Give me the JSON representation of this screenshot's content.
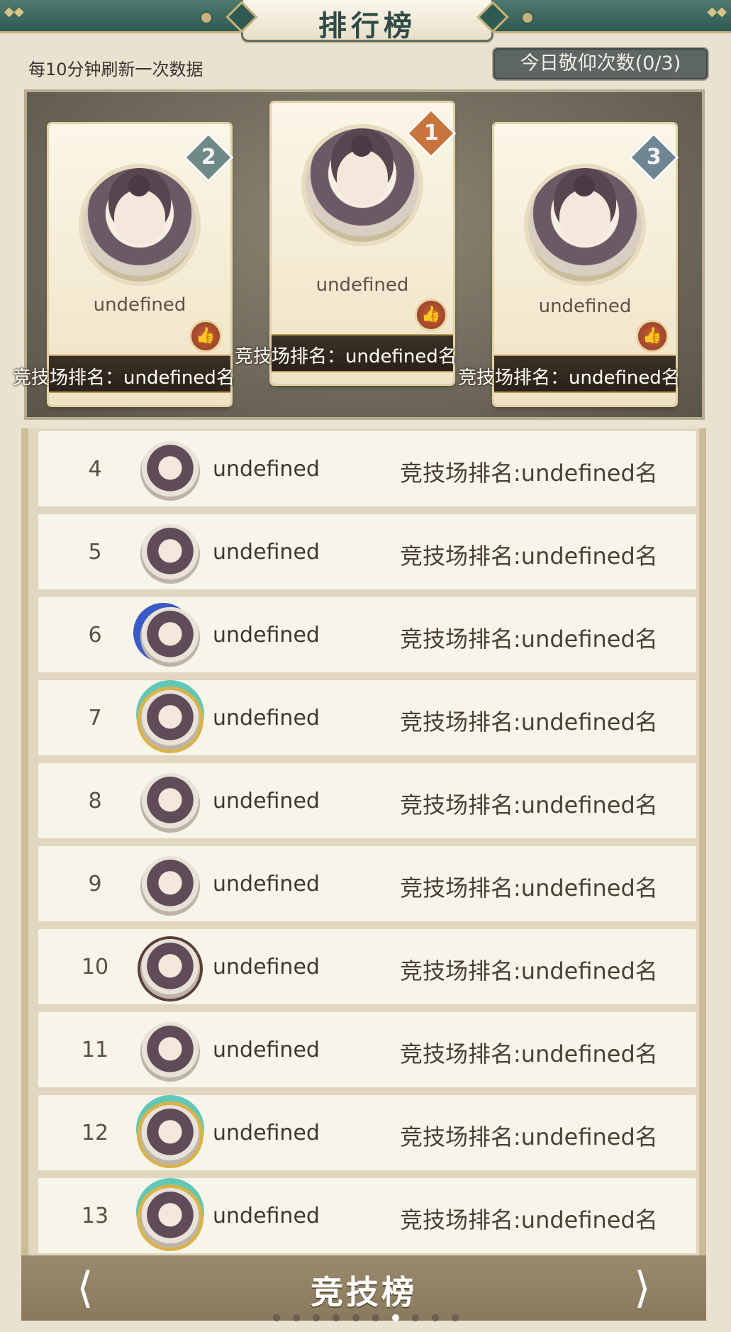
{
  "header": {
    "title": "排行榜"
  },
  "refresh_text": "每10分钟刷新一次数据",
  "worship_button": "今日敬仰次数(0/3)",
  "podium": [
    {
      "rank": "2",
      "name": "undefined",
      "arena": "竞技场排名：undefined名"
    },
    {
      "rank": "1",
      "name": "undefined",
      "arena": "竞技场排名：undefined名"
    },
    {
      "rank": "3",
      "name": "undefined",
      "arena": "竞技场排名：undefined名"
    }
  ],
  "list": [
    {
      "rank": "4",
      "name": "undefined",
      "arena": "竞技场排名:undefined名"
    },
    {
      "rank": "5",
      "name": "undefined",
      "arena": "竞技场排名:undefined名"
    },
    {
      "rank": "6",
      "name": "undefined",
      "arena": "竞技场排名:undefined名"
    },
    {
      "rank": "7",
      "name": "undefined",
      "arena": "竞技场排名:undefined名"
    },
    {
      "rank": "8",
      "name": "undefined",
      "arena": "竞技场排名:undefined名"
    },
    {
      "rank": "9",
      "name": "undefined",
      "arena": "竞技场排名:undefined名"
    },
    {
      "rank": "10",
      "name": "undefined",
      "arena": "竞技场排名:undefined名"
    },
    {
      "rank": "11",
      "name": "undefined",
      "arena": "竞技场排名:undefined名"
    },
    {
      "rank": "12",
      "name": "undefined",
      "arena": "竞技场排名:undefined名"
    },
    {
      "rank": "13",
      "name": "undefined",
      "arena": "竞技场排名:undefined名"
    }
  ],
  "footer": {
    "title": "竞技榜",
    "page_index": 7,
    "page_count": 10
  },
  "colors": {
    "title_bar": "#2f5a52",
    "gold": "#c9b27a",
    "card": "#f7f4ea"
  }
}
